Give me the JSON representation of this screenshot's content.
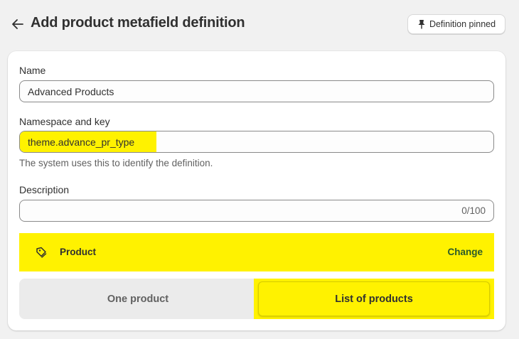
{
  "header": {
    "title": "Add product metafield definition",
    "pin_label": "Definition pinned"
  },
  "form": {
    "name_label": "Name",
    "name_value": "Advanced Products",
    "namespace_label": "Namespace and key",
    "namespace_value": "theme.advance_pr_type",
    "namespace_help": "The system uses this to identify the definition.",
    "description_label": "Description",
    "description_value": "",
    "description_counter": "0/100"
  },
  "type": {
    "name": "Product",
    "change_label": "Change",
    "options": [
      "One product",
      "List of products"
    ],
    "selected": "List of products"
  },
  "colors": {
    "highlight": "#fff200",
    "page_bg": "#f1f1f1",
    "link": "#2a5a2a"
  },
  "icons": {
    "back": "arrow-left-icon",
    "pin": "pin-icon",
    "type": "product-tag-icon"
  }
}
